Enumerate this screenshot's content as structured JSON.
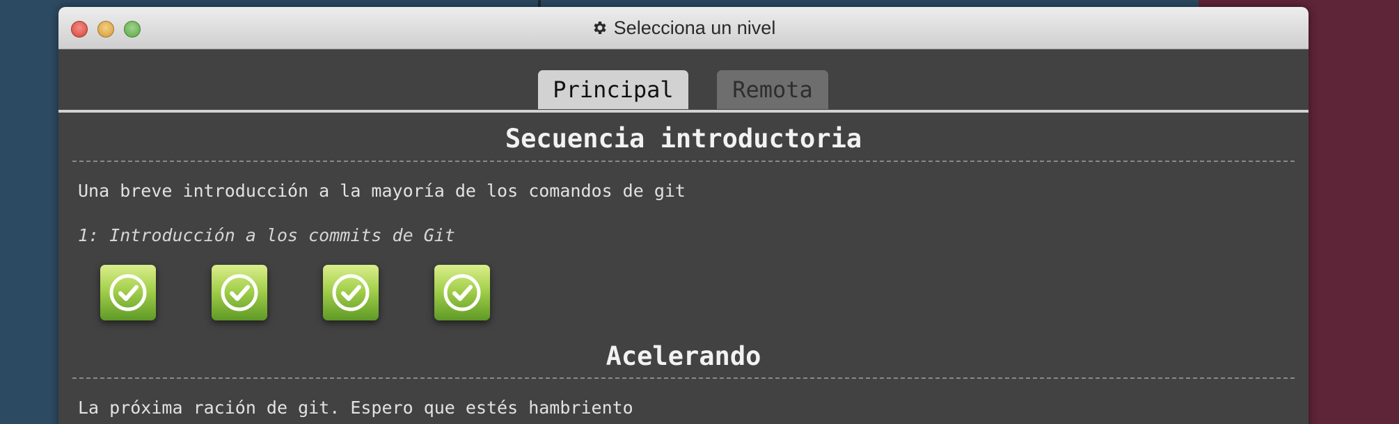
{
  "window": {
    "title": "Selecciona un nivel",
    "title_icon": "gear-icon"
  },
  "tabs": [
    {
      "label": "Principal",
      "active": true
    },
    {
      "label": "Remota",
      "active": false
    }
  ],
  "sections": [
    {
      "title": "Secuencia introductoria",
      "description": "Una breve introducción a la mayoría de los comandos de git",
      "level_group": "1: Introducción a los commits de Git",
      "levels": [
        {
          "status": "completed",
          "icon": "check-icon"
        },
        {
          "status": "completed",
          "icon": "check-icon"
        },
        {
          "status": "completed",
          "icon": "check-icon"
        },
        {
          "status": "completed",
          "icon": "check-icon"
        }
      ]
    },
    {
      "title": "Acelerando",
      "description": "La próxima ración de git. Espero que estés hambriento"
    }
  ],
  "colors": {
    "window_bg": "#424242",
    "tab_active": "#d2d2d2",
    "tab_inactive": "#6e6e6e",
    "level_complete": "#8cc63f",
    "bg_right": "#5e2437",
    "bg_left": "#2d4a63"
  }
}
